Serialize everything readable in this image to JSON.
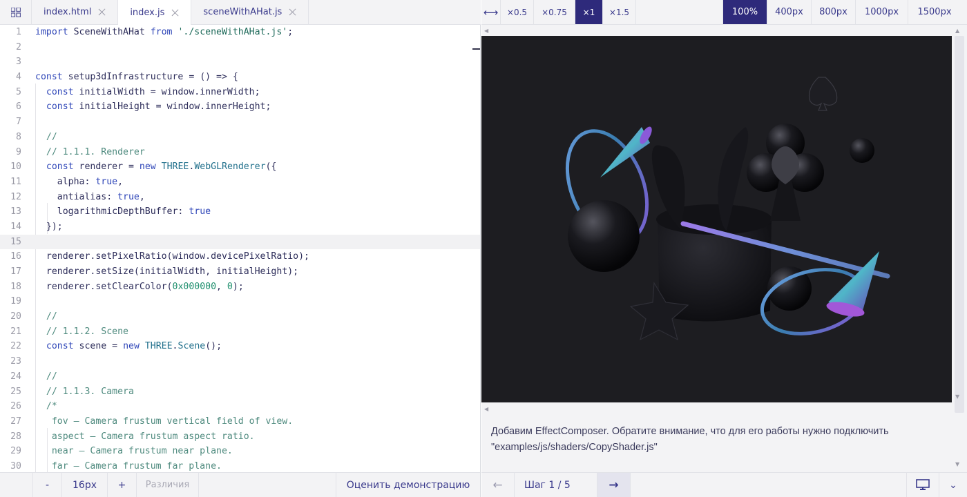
{
  "tabs": [
    {
      "label": "index.html",
      "active": false
    },
    {
      "label": "index.js",
      "active": true
    },
    {
      "label": "sceneWithAHat.js",
      "active": false
    }
  ],
  "code": {
    "line_numbers": [
      "1",
      "2",
      "3",
      "4",
      "5",
      "6",
      "7",
      "8",
      "9",
      "10",
      "11",
      "12",
      "13",
      "14",
      "15",
      "16",
      "17",
      "18",
      "19",
      "20",
      "21",
      "22",
      "23",
      "24",
      "25",
      "26",
      "27",
      "28",
      "29",
      "30"
    ],
    "lines": [
      "import SceneWithAHat from './sceneWithAHat.js';",
      "",
      "",
      "const setup3dInfrastructure = () => {",
      "  const initialWidth = window.innerWidth;",
      "  const initialHeight = window.innerHeight;",
      "",
      "  //",
      "  // 1.1.1. Renderer",
      "  const renderer = new THREE.WebGLRenderer({",
      "    alpha: true,",
      "    antialias: true,",
      "    logarithmicDepthBuffer: true",
      "  });",
      "",
      "  renderer.setPixelRatio(window.devicePixelRatio);",
      "  renderer.setSize(initialWidth, initialHeight);",
      "  renderer.setClearColor(0x000000, 0);",
      "",
      "  //",
      "  // 1.1.2. Scene",
      "  const scene = new THREE.Scene();",
      "",
      "  //",
      "  // 1.1.3. Camera",
      "  /*",
      "   fov — Camera frustum vertical field of view.",
      "   aspect — Camera frustum aspect ratio.",
      "   near — Camera frustum near plane.",
      "   far — Camera frustum far plane."
    ],
    "highlighted_line": 15
  },
  "editor_toolbar": {
    "decrease_label": "-",
    "font_size": "16px",
    "increase_label": "+",
    "diff_label": "Различия",
    "rate_label": "Оценить демонстрацию"
  },
  "preview_toolbar": {
    "toggle_icon": "⟷",
    "scales": [
      "×0.5",
      "×0.75",
      "×1",
      "×1.5"
    ],
    "active_scale": "×1",
    "widths": [
      "100%",
      "400px",
      "800px",
      "1000px",
      "1500px"
    ],
    "active_width": "100%"
  },
  "description": {
    "line1": "Добавим EffectComposer. Обратите внимание, что для его работы нужно подключить",
    "line2": "\"examples/js/shaders/CopyShader.js\""
  },
  "step_nav": {
    "prev_icon": "←",
    "step_label": "Шаг 1 / 5",
    "next_icon": "→",
    "more_icon": "⌄"
  },
  "colors": {
    "accent": "#2e2a7b",
    "scene_background": "#1d1d21",
    "tab_text": "#3a3a8c"
  }
}
